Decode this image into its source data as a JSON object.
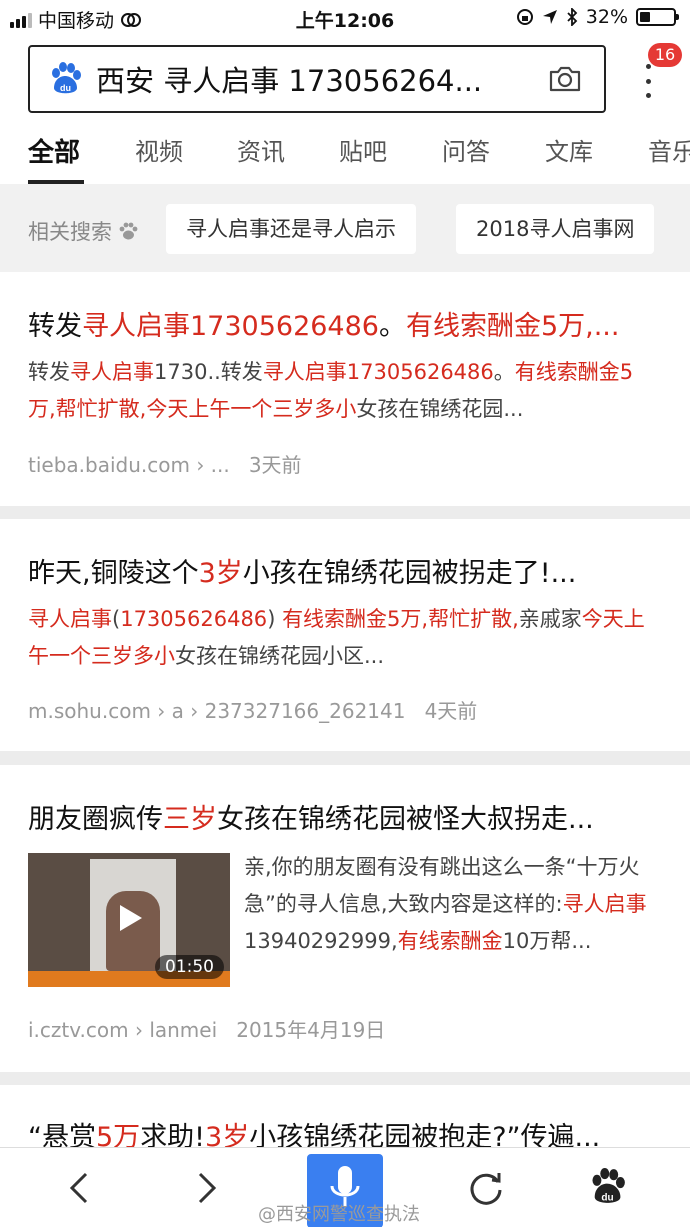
{
  "status_bar": {
    "carrier": "中国移动",
    "time": "上午12:06",
    "battery": "32%",
    "battery_level": 0.32
  },
  "search": {
    "query": "西安 寻人启事 173056264..."
  },
  "notifications": {
    "count": "16"
  },
  "tabs": [
    "全部",
    "视频",
    "资讯",
    "贴吧",
    "问答",
    "文库",
    "音乐"
  ],
  "related": {
    "label": "相关搜索",
    "chips": [
      "寻人启事还是寻人启示",
      "2018寻人启事网"
    ]
  },
  "results": [
    {
      "title": [
        {
          "t": "转发",
          "h": false
        },
        {
          "t": "寻人启事17305626486",
          "h": true
        },
        {
          "t": "。",
          "h": false
        },
        {
          "t": "有线索酬金5万,...",
          "h": true
        }
      ],
      "snippet": [
        {
          "t": "转发",
          "h": false
        },
        {
          "t": "寻人启事",
          "h": true
        },
        {
          "t": "1730..转发",
          "h": false
        },
        {
          "t": "寻人启事17305626486",
          "h": true
        },
        {
          "t": "。",
          "h": false
        },
        {
          "t": "有线索酬金5万,帮忙扩散,今天上午一个三岁多小",
          "h": true
        },
        {
          "t": "女孩在锦绣花园...",
          "h": false
        }
      ],
      "url": "tieba.baidu.com › ...",
      "time": "3天前"
    },
    {
      "title": [
        {
          "t": "昨天,铜陵这个",
          "h": false
        },
        {
          "t": "3岁",
          "h": true
        },
        {
          "t": "小孩在锦绣花园被拐走了!...",
          "h": false
        }
      ],
      "snippet": [
        {
          "t": "寻人启事",
          "h": true
        },
        {
          "t": "(",
          "h": false
        },
        {
          "t": "17305626486",
          "h": true
        },
        {
          "t": ") ",
          "h": false
        },
        {
          "t": "有线索酬金5万,帮忙扩散,",
          "h": true
        },
        {
          "t": "亲戚家",
          "h": false
        },
        {
          "t": "今天上午一个三岁多小",
          "h": true
        },
        {
          "t": "女孩在锦绣花园小区...",
          "h": false
        }
      ],
      "url": "m.sohu.com › a › 237327166_262141",
      "time": "4天前"
    },
    {
      "title": [
        {
          "t": "朋友圈疯传",
          "h": false
        },
        {
          "t": "三岁",
          "h": true
        },
        {
          "t": "女孩在锦绣花园被怪大叔拐走...",
          "h": false
        }
      ],
      "snippet": [
        {
          "t": "亲,你的朋友圈有没有跳出这么一条“十万火急”的寻人信息,大致内容是这样的:",
          "h": false
        },
        {
          "t": "寻人启事",
          "h": true
        },
        {
          "t": "13940292999,",
          "h": false
        },
        {
          "t": "有线索酬金",
          "h": true
        },
        {
          "t": "10万帮...",
          "h": false
        }
      ],
      "video_duration": "01:50",
      "url": "i.cztv.com › lanmei",
      "time": "2015年4月19日"
    },
    {
      "title": [
        {
          "t": "“悬赏",
          "h": false
        },
        {
          "t": "5万",
          "h": true
        },
        {
          "t": "求助!",
          "h": false
        },
        {
          "t": "3岁",
          "h": true
        },
        {
          "t": "小孩锦绣花园被抱走?”传遍...",
          "h": false
        }
      ]
    }
  ],
  "watermark": "@西安网警巡查执法",
  "colors": {
    "highlight": "#d52b1e",
    "accent": "#3a7ff0",
    "badge": "#e53935"
  },
  "icons": [
    "baidu-paw-icon",
    "camera-icon",
    "more-vertical-icon",
    "back-arrow-icon",
    "forward-arrow-icon",
    "microphone-icon",
    "refresh-icon",
    "baidu-home-icon"
  ]
}
